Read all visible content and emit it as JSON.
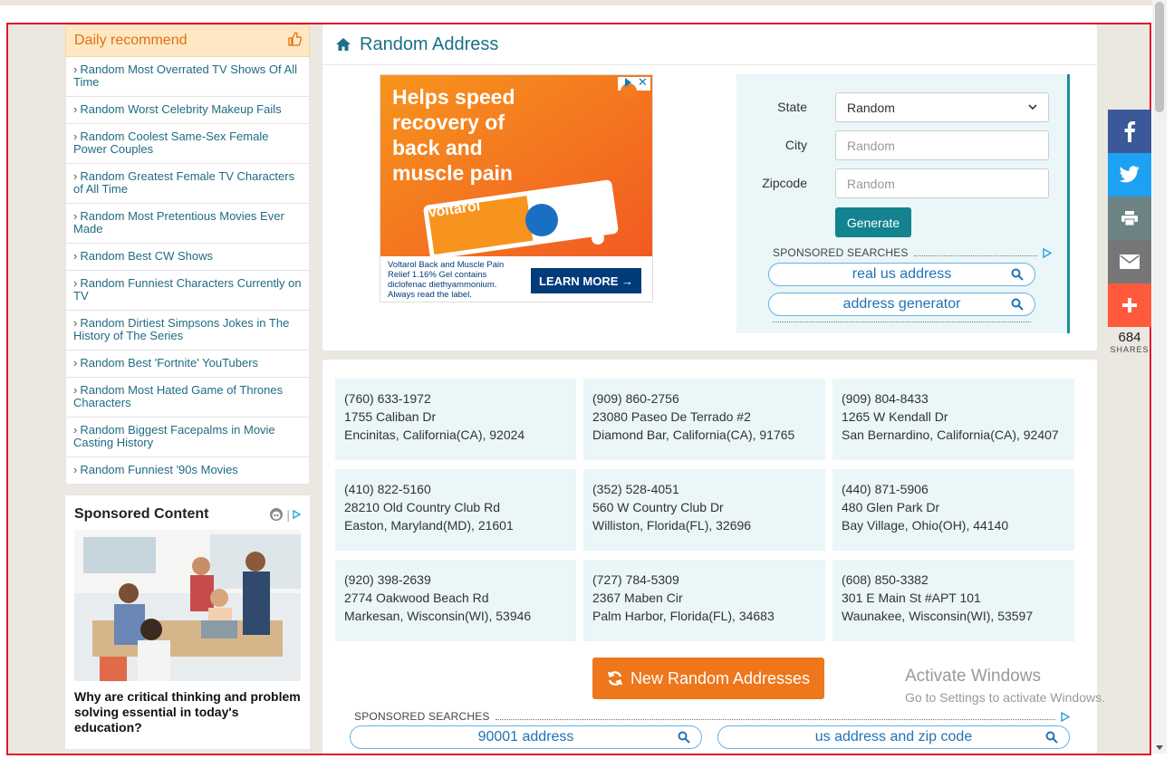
{
  "sidebar": {
    "daily_title": "Daily recommend",
    "items": [
      {
        "label": "Random Most Overrated TV Shows Of All Time"
      },
      {
        "label": "Random Worst Celebrity Makeup Fails"
      },
      {
        "label": "Random Coolest Same-Sex Female Power Couples"
      },
      {
        "label": "Random Greatest Female TV Characters of All Time"
      },
      {
        "label": "Random Most Pretentious Movies Ever Made"
      },
      {
        "label": "Random Best CW Shows"
      },
      {
        "label": "Random Funniest Characters Currently on TV"
      },
      {
        "label": "Random Dirtiest Simpsons Jokes in The History of The Series"
      },
      {
        "label": "Random Best 'Fortnite' YouTubers"
      },
      {
        "label": "Random Most Hated Game of Thrones Characters"
      },
      {
        "label": "Random Biggest Facepalms in Movie Casting History"
      },
      {
        "label": "Random Funniest '90s Movies"
      }
    ],
    "sponsored_title": "Sponsored Content",
    "sponsored_caption": "Why are critical thinking and problem solving essential in today's education?"
  },
  "main": {
    "title": "Random Address",
    "ad": {
      "headline": "Helps speed recovery of back and muscle pain",
      "brand": "Voltarol",
      "fine_print": "Voltarol Back and Muscle Pain Relief 1.16% Gel contains diclofenac diethyammonium. Always read the label.",
      "cta": "LEARN MORE →"
    },
    "form": {
      "state_label": "State",
      "state_value": "Random",
      "city_label": "City",
      "city_placeholder": "Random",
      "zip_label": "Zipcode",
      "zip_placeholder": "Random",
      "generate_label": "Generate"
    },
    "sponsored_searches_label": "SPONSORED SEARCHES",
    "side_searches": [
      "real us address",
      "address generator"
    ],
    "addresses": [
      {
        "phone": "(760) 633-1972",
        "street": "1755 Caliban Dr",
        "city": "Encinitas, California(CA), 92024"
      },
      {
        "phone": "(909) 860-2756",
        "street": "23080 Paseo De Terrado #2",
        "city": "Diamond Bar, California(CA), 91765"
      },
      {
        "phone": "(909) 804-8433",
        "street": "1265 W Kendall Dr",
        "city": "San Bernardino, California(CA), 92407"
      },
      {
        "phone": "(410) 822-5160",
        "street": "28210 Old Country Club Rd",
        "city": "Easton, Maryland(MD), 21601"
      },
      {
        "phone": "(352) 528-4051",
        "street": "560 W Country Club Dr",
        "city": "Williston, Florida(FL), 32696"
      },
      {
        "phone": "(440) 871-5906",
        "street": "480 Glen Park Dr",
        "city": "Bay Village, Ohio(OH), 44140"
      },
      {
        "phone": "(920) 398-2639",
        "street": "2774 Oakwood Beach Rd",
        "city": "Markesan, Wisconsin(WI), 53946"
      },
      {
        "phone": "(727) 784-5309",
        "street": "2367 Maben Cir",
        "city": "Palm Harbor, Florida(FL), 34683"
      },
      {
        "phone": "(608) 850-3382",
        "street": "301 E Main St #APT 101",
        "city": "Waunakee, Wisconsin(WI), 53597"
      }
    ],
    "new_button_label": "New Random Addresses",
    "bottom_searches": [
      "90001 address",
      "us address and zip code"
    ]
  },
  "share": {
    "count": "684",
    "label": "SHARES",
    "colors": {
      "facebook": "#3b5998",
      "twitter": "#1da1f2",
      "print": "#6d8384",
      "email": "#767676",
      "more": "#ff5a3c"
    }
  },
  "windows_watermark": {
    "title": "Activate Windows",
    "subtitle": "Go to Settings to activate Windows."
  }
}
